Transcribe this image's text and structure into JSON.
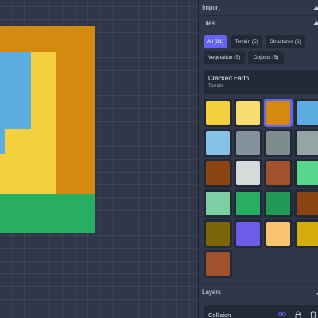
{
  "panel": {
    "import_title": "Import",
    "tiles_title": "Tiles",
    "layers_title": "Layers"
  },
  "filters": [
    {
      "label": "All (21)",
      "active": true
    },
    {
      "label": "Terrain (5)",
      "active": false
    },
    {
      "label": "Structures (6)",
      "active": false
    },
    {
      "label": "Vegetation (5)",
      "active": false
    },
    {
      "label": "Objects (5)",
      "active": false
    }
  ],
  "selected_tile": {
    "name": "Cracked Earth",
    "category": "Terrain"
  },
  "tile_colors": [
    "#f4d03f",
    "#f7dc6f",
    "#d4890f",
    "#5dade2",
    "#85c1e9",
    "#85929e",
    "#7f8c8d",
    "#95a5a6",
    "#8b4513",
    "#d5dbdb",
    "#a0522d",
    "#58d68d",
    "#7dcea0",
    "#27ae60",
    "#229954",
    "#8b4513",
    "#7d6608",
    "#6c5ce7",
    "#f8c471",
    "#d4ac0d",
    "#a0522d"
  ],
  "selected_tile_index": 2,
  "layers": [
    {
      "name": "Collision",
      "visible": true,
      "locked": false
    }
  ],
  "colors": {
    "accent": "#6466f1",
    "background": "#2f3748",
    "panel_item": "#222937"
  }
}
